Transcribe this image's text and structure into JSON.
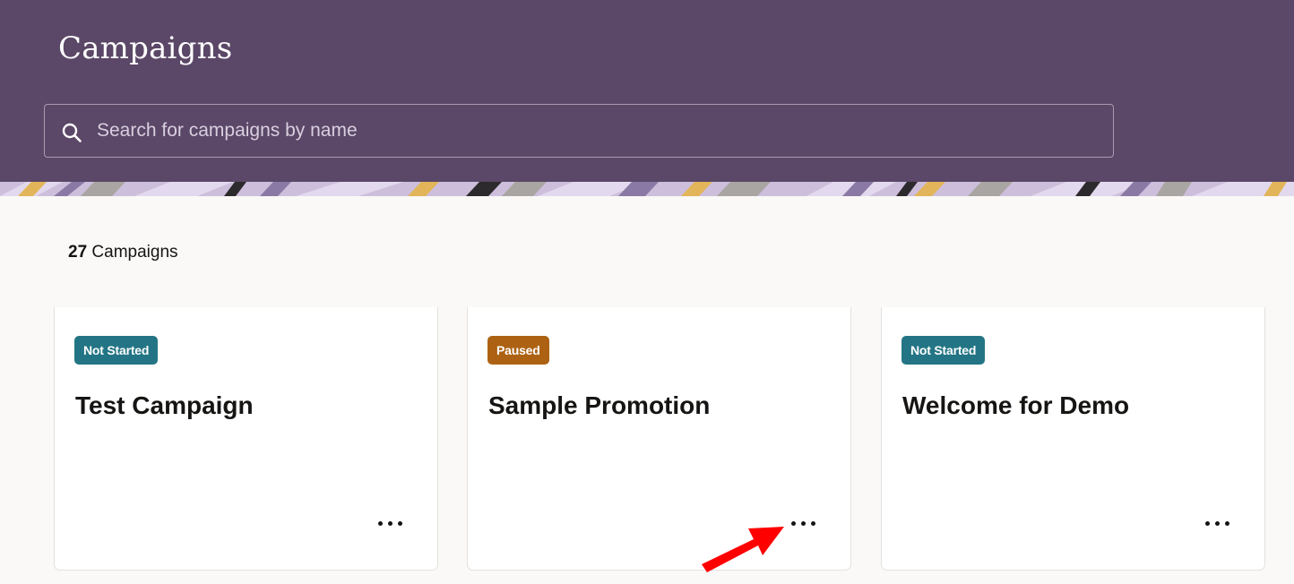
{
  "header": {
    "title": "Campaigns",
    "bg_color": "#5b4767"
  },
  "search": {
    "placeholder": "Search for campaigns by name",
    "value": "",
    "icon": "search-icon"
  },
  "summary": {
    "count": "27",
    "label": "Campaigns"
  },
  "cards": [
    {
      "status": "Not Started",
      "status_color": "#237585",
      "title": "Test Campaign",
      "menu_icon": "more-options-icon"
    },
    {
      "status": "Paused",
      "status_color": "#ad6213",
      "title": "Sample Promotion",
      "menu_icon": "more-options-icon"
    },
    {
      "status": "Not Started",
      "status_color": "#237585",
      "title": "Welcome for Demo",
      "menu_icon": "more-options-icon"
    }
  ],
  "annotation": {
    "icon": "red-arrow-icon",
    "color": "#ff0000"
  }
}
